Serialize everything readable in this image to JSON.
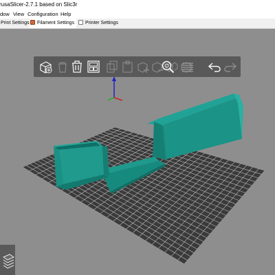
{
  "window": {
    "title": "rusaSlicer-2.7.1 based on Slic3r"
  },
  "menu": {
    "items": [
      "dow",
      "View",
      "Configuration",
      "Help"
    ]
  },
  "tabs": [
    {
      "label": "Print Settings",
      "icon": "print-settings-icon",
      "color": "#d9d9d9"
    },
    {
      "label": "Filament Settings",
      "icon": "filament-icon",
      "color": "#d06a3a"
    },
    {
      "label": "Printer Settings",
      "icon": "printer-icon",
      "color": "#bdbdbd"
    }
  ],
  "toolbar": {
    "buttons": [
      "add-object-icon",
      "delete-icon",
      "delete-all-icon",
      "arrange-icon",
      "copy-icon",
      "paste-icon",
      "add-instance-icon",
      "remove-instance-icon",
      "split-objects-icon",
      "split-parts-icon",
      "search-icon",
      "layer-editing-icon",
      "undo-icon",
      "redo-icon"
    ]
  },
  "colors": {
    "accent": "#ed6b21",
    "model": "#1f9a8e",
    "bed": "#3b3b3b",
    "background": "#8e8e8e"
  }
}
